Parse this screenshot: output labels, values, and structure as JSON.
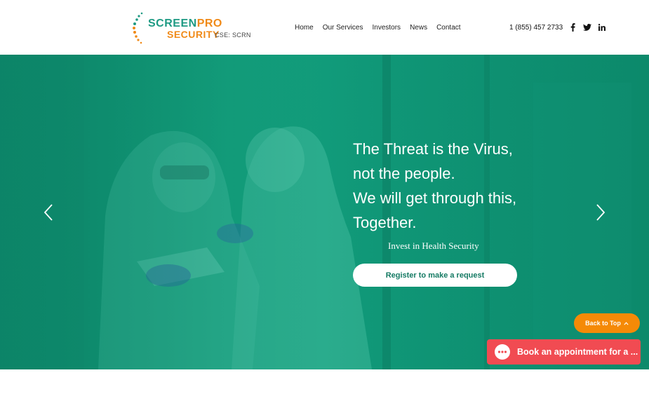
{
  "header": {
    "logo": {
      "word1_a": "SCREEN",
      "word1_b": "PRO",
      "word2": "SECURITY",
      "ticker": "CSE: SCRN"
    },
    "nav": [
      {
        "label": "Home"
      },
      {
        "label": "Our Services"
      },
      {
        "label": "Investors"
      },
      {
        "label": "News"
      },
      {
        "label": "Contact"
      }
    ],
    "phone": "1 (855) 457 2733",
    "social": [
      "facebook-icon",
      "twitter-icon",
      "linkedin-icon"
    ]
  },
  "hero": {
    "headline": [
      "The Threat is the Virus,",
      "not the people.",
      "We will get through this,",
      "Together."
    ],
    "subheadline": "Invest in Health Security",
    "cta_label": "Register to make a request",
    "prev_icon": "chevron-left-icon",
    "next_icon": "chevron-right-icon"
  },
  "widgets": {
    "back_to_top": "Back to Top",
    "book_label": "Book an appointment for a ..."
  },
  "colors": {
    "brand_green": "#1e9a83",
    "brand_orange": "#f08a18",
    "hero_teal": "#13a07d",
    "back_to_top": "#f58a07",
    "book_button": "#f14b52"
  }
}
